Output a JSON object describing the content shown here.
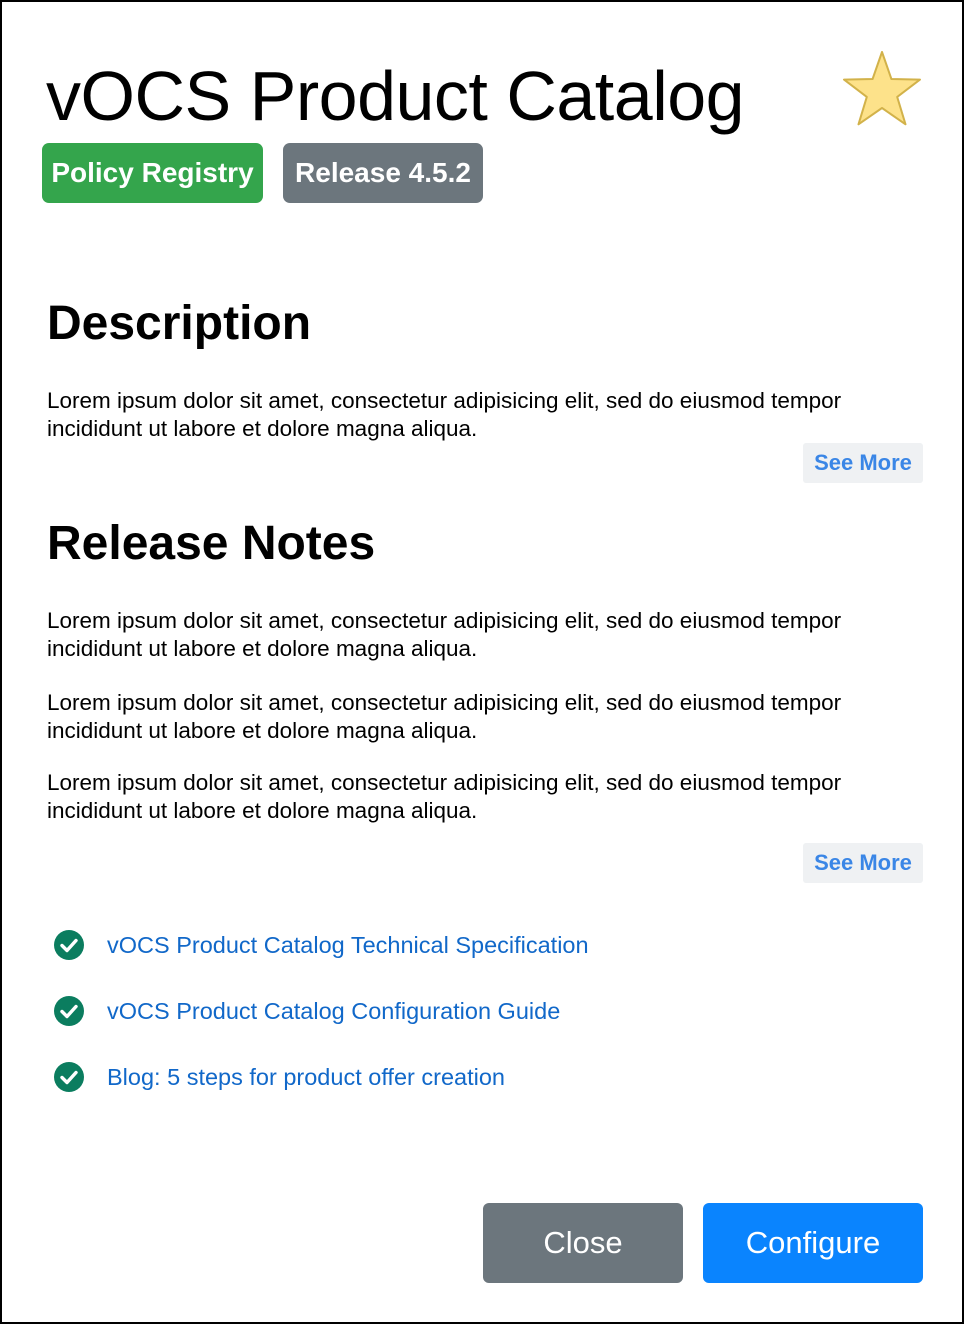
{
  "header": {
    "title": "vOCS Product Catalog",
    "favorite_icon": "star-icon",
    "badges": [
      {
        "label": "Policy Registry",
        "color": "#34a54c"
      },
      {
        "label": "Release 4.5.2",
        "color": "#6c767d"
      }
    ]
  },
  "description": {
    "heading": "Description",
    "paragraph": "Lorem ipsum dolor sit amet, consectetur adipisicing elit, sed do eiusmod tempor incididunt ut labore et dolore magna aliqua.",
    "see_more_label": "See More"
  },
  "release_notes": {
    "heading": "Release Notes",
    "paragraphs": [
      "Lorem ipsum dolor sit amet, consectetur adipisicing elit, sed do eiusmod tempor incididunt ut labore et dolore magna aliqua.",
      "Lorem ipsum dolor sit amet, consectetur adipisicing elit, sed do eiusmod tempor incididunt ut labore et dolore magna aliqua.",
      "Lorem ipsum dolor sit amet, consectetur adipisicing elit, sed do eiusmod tempor incididunt ut labore et dolore magna aliqua."
    ],
    "see_more_label": "See More"
  },
  "links": [
    {
      "label": "vOCS Product Catalog Technical Specification",
      "icon": "check-circle-icon"
    },
    {
      "label": "vOCS Product Catalog Configuration Guide",
      "icon": "check-circle-icon"
    },
    {
      "label": "Blog: 5 steps for product offer creation",
      "icon": "check-circle-icon"
    }
  ],
  "footer": {
    "close_label": "Close",
    "configure_label": "Configure"
  },
  "colors": {
    "accent": "#0a84fe",
    "success": "#34a54c",
    "secondary": "#6c767d",
    "link": "#1168c9",
    "check": "#0b7d5f",
    "star": "#fde28a"
  }
}
